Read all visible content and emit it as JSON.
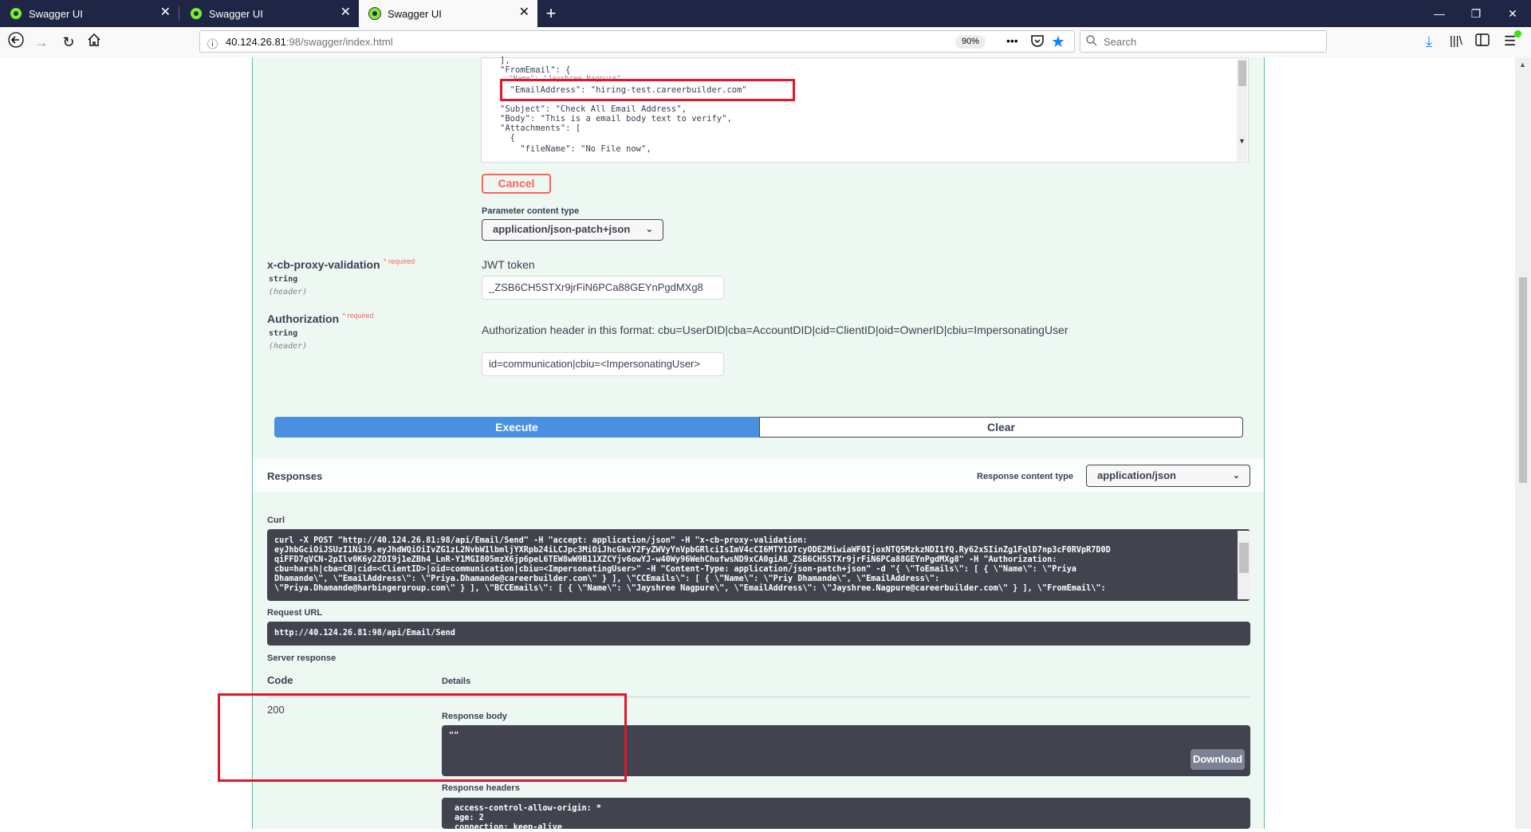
{
  "browser": {
    "tabs": [
      {
        "title": "Swagger UI",
        "close": "✕"
      },
      {
        "title": "Swagger UI",
        "close": "✕"
      },
      {
        "title": "Swagger UI",
        "close": "✕"
      }
    ],
    "new_tab": "+",
    "window_buttons": {
      "minimize": "—",
      "restore": "❐",
      "close": "✕"
    },
    "url_host": "40.124.26.81",
    "url_path": ":98/swagger/index.html",
    "zoom": "90%",
    "page_actions": "•••",
    "search_placeholder": "Search"
  },
  "request_body": {
    "lines": [
      "],",
      "\"FromEmail\": {",
      "  \"Name\": \"Jayshree Nagpure\",",
      "  \"EmailAddress\": \"hiring-test.careerbuilder.com\"",
      "},",
      "\"Subject\": \"Check All Email Address\",",
      "\"Body\": \"This is a email body text to verify\",",
      "\"Attachments\": [",
      "  {",
      "    \"fileName\": \"No File now\","
    ]
  },
  "cancel_label": "Cancel",
  "parameter_content_type": {
    "label": "Parameter content type",
    "value": "application/json-patch+json"
  },
  "params": [
    {
      "name": "x-cb-proxy-validation",
      "required": "* required",
      "type": "string",
      "in": "(header)",
      "description": "JWT token",
      "value": "_ZSB6CH5STXr9jrFiN6PCa88GEYnPgdMXg8"
    },
    {
      "name": "Authorization",
      "required": "* required",
      "type": "string",
      "in": "(header)",
      "description": "Authorization header in this format: cbu=UserDID|cba=AccountDID|cid=ClientID|oid=OwnerID|cbiu=ImpersonatingUser",
      "value": "id=communication|cbiu=<ImpersonatingUser>"
    }
  ],
  "execute_label": "Execute",
  "clear_label": "Clear",
  "responses": {
    "title": "Responses",
    "content_type_label": "Response content type",
    "content_type_value": "application/json",
    "curl_label": "Curl",
    "curl_lines": [
      "curl -X POST \"http://40.124.26.81:98/api/Email/Send\" -H \"accept: application/json\" -H \"x-cb-proxy-validation:",
      "eyJhbGciOiJSUzI1NiJ9.eyJhdWQiOiIvZG1zL2NvbW1lbmljYXRpb24iLCJpc3MiOiJhcGkuY2FyZWVyYnVpbGRlciIsImV4cCI6MTY1OTcyODE2MiwiaWF0IjoxNTQ5MzkzNDI1fQ.Ry62xSIinZg1FqlD7np3cF0RVpR7D0D",
      "qiFFD7qVCN-2pIlv0K6y2ZOI9j1eZBh4_LnR-Y1MGI805mzX6jp6peL6TEW8wW9B11XZCYjv6owYJ-w40Wy96WehChufwsND9xCA0giA8_ZSB6CH5STXr9jrFiN6PCa88GEYnPgdMXg8\" -H \"Authorization:",
      "cbu=harsh|cba=CB|cid=<ClientID>|oid=communication|cbiu=<ImpersonatingUser>\" -H \"Content-Type: application/json-patch+json\" -d \"{ \\\"ToEmails\\\": [ { \\\"Name\\\": \\\"Priya",
      "Dhamande\\\", \\\"EmailAddress\\\": \\\"Priya.Dhamande@careerbuilder.com\\\" } ], \\\"CCEmails\\\": [ { \\\"Name\\\": \\\"Priy Dhamande\\\", \\\"EmailAddress\\\":",
      "\\\"Priya.Dhamande@harbingergroup.com\\\" } ], \\\"BCCEmails\\\": [ { \\\"Name\\\": \\\"Jayshree Nagpure\\\", \\\"EmailAddress\\\": \\\"Jayshree.Nagpure@careerbuilder.com\\\" } ], \\\"FromEmail\\\":"
    ],
    "request_url_label": "Request URL",
    "request_url": "http://40.124.26.81:98/api/Email/Send",
    "server_response_label": "Server response",
    "code_header": "Code",
    "details_header": "Details",
    "code": "200",
    "response_body_label": "Response body",
    "response_body": "\"\"",
    "download_label": "Download",
    "response_headers_label": "Response headers",
    "response_headers_lines": [
      "access-control-allow-origin: *",
      "age: 2",
      "connection: keep-alive"
    ]
  },
  "colors": {
    "accent_post": "#49cc90",
    "execute": "#4990e2",
    "highlight": "#e3152b"
  }
}
